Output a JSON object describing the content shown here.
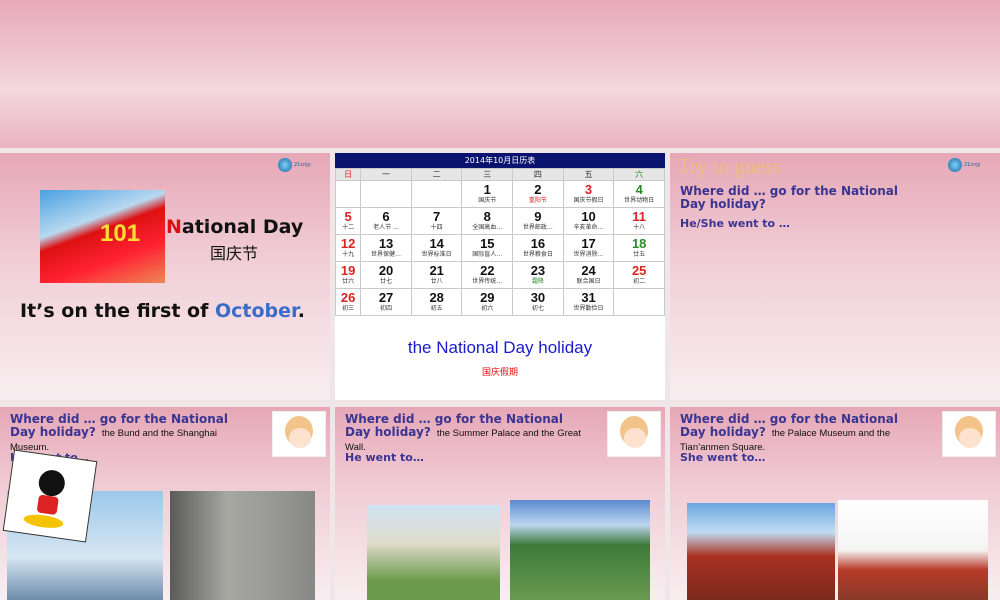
{
  "slide1": {
    "title_initial": "N",
    "title_rest": "ational Day",
    "title_cn": "国庆节",
    "sentence_pre": "It’s on the first of ",
    "sentence_month": "October",
    "sentence_end": "."
  },
  "slide2": {
    "calendar_title": "2014年10月日历表",
    "weekdays": [
      "日",
      "一",
      "二",
      "三",
      "四",
      "五",
      "六"
    ],
    "weeks": [
      [
        null,
        null,
        null,
        {
          "d": "1",
          "s": "国庆节"
        },
        {
          "d": "2",
          "s": "重阳节",
          "sc": "#d22"
        },
        {
          "d": "3",
          "s": "国庆节假日",
          "dc": "#d22"
        },
        {
          "d": "4",
          "s": "世界动物日",
          "dc": "#2a8a2a"
        }
      ],
      [
        {
          "d": "5",
          "s": "十二",
          "dc": "#d22"
        },
        {
          "d": "6",
          "s": "老人节 …"
        },
        {
          "d": "7",
          "s": "十四"
        },
        {
          "d": "8",
          "s": "全国高血…"
        },
        {
          "d": "9",
          "s": "世界邮政…"
        },
        {
          "d": "10",
          "s": "辛亥革命…"
        },
        {
          "d": "11",
          "s": "十八",
          "dc": "#d22"
        }
      ],
      [
        {
          "d": "12",
          "s": "十九",
          "dc": "#d22"
        },
        {
          "d": "13",
          "s": "世界保健…"
        },
        {
          "d": "14",
          "s": "世界标准日"
        },
        {
          "d": "15",
          "s": "国际盲人…"
        },
        {
          "d": "16",
          "s": "世界粮食日"
        },
        {
          "d": "17",
          "s": "世界消除…"
        },
        {
          "d": "18",
          "s": "廿五",
          "dc": "#2a8a2a"
        }
      ],
      [
        {
          "d": "19",
          "s": "廿六",
          "dc": "#d22"
        },
        {
          "d": "20",
          "s": "廿七"
        },
        {
          "d": "21",
          "s": "廿八"
        },
        {
          "d": "22",
          "s": "世界传统…"
        },
        {
          "d": "23",
          "s": "霜降",
          "sc": "#2a8a2a"
        },
        {
          "d": "24",
          "s": "联合国日"
        },
        {
          "d": "25",
          "s": "初二",
          "dc": "#d22"
        }
      ],
      [
        {
          "d": "26",
          "s": "初三",
          "dc": "#d22"
        },
        {
          "d": "27",
          "s": "初四"
        },
        {
          "d": "28",
          "s": "初五"
        },
        {
          "d": "29",
          "s": "初六"
        },
        {
          "d": "30",
          "s": "初七"
        },
        {
          "d": "31",
          "s": "世界勤俭日"
        },
        null
      ]
    ],
    "caption": "the National Day holiday",
    "caption_cn": "国庆假期"
  },
  "slide3": {
    "heading": "Try to guess",
    "question": "Where did … go for the National Day holiday?",
    "prompt": "He/She went to …"
  },
  "slide4": {
    "question": "Where did … go for the National Day holiday?",
    "answer": "the Bund and the Shanghai Museum.",
    "prompt": "He went to…"
  },
  "slide5": {
    "question": "Where did … go for the National Day holiday?",
    "answer": "the Summer Palace and the Great Wall.",
    "prompt": "He went to…"
  },
  "slide6": {
    "question": "Where did … go for the National Day holiday?",
    "answer": "the Palace Museum and the Tian’anmen Square.",
    "prompt": "She went to…"
  }
}
